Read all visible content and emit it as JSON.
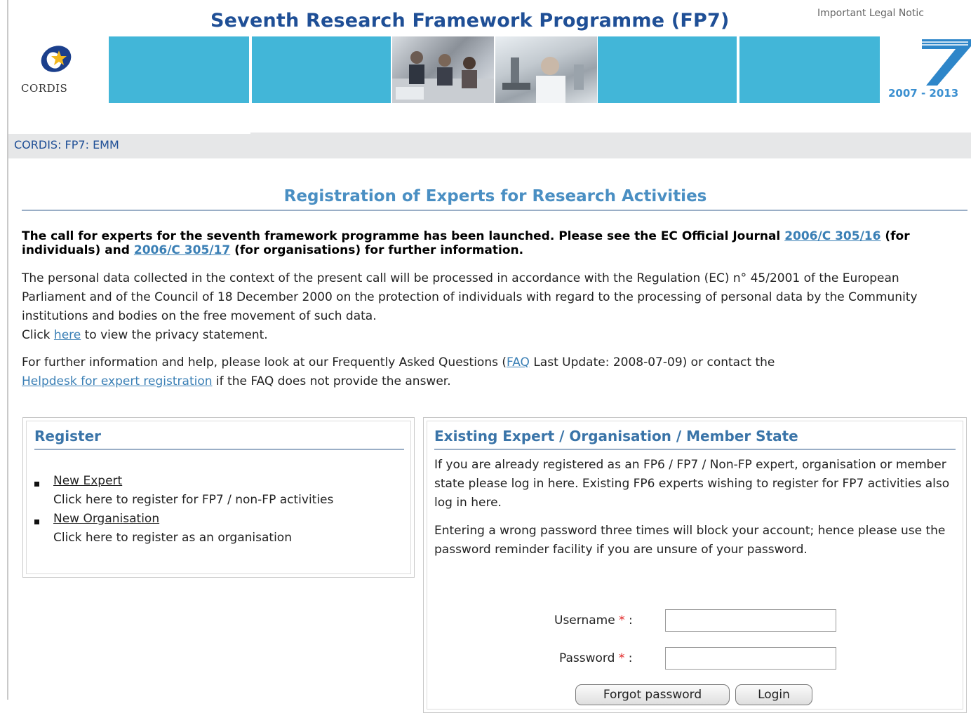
{
  "header": {
    "title": "Seventh Research Framework Programme (FP7)",
    "legal_notice": "Important Legal Notic",
    "logo_text": "CORDIS",
    "fp7_years": "2007 - 2013"
  },
  "breadcrumb": "CORDIS: FP7: EMM",
  "page_title": "Registration of Experts for Research Activities",
  "announcement": {
    "text_before": "The call for experts for the seventh framework programme has been launched. Please see the EC Official Journal",
    "link1": "2006/C 305/16",
    "text_mid": "(for individuals) and",
    "link2": "2006/C 305/17",
    "text_after": "(for organisations) for further information."
  },
  "privacy": {
    "text": "The personal data collected in the context of the present call will be processed in accordance with the Regulation (EC) n° 45/2001 of the European Parliament and of the Council of 18 December 2000 on the protection of individuals with regard to the processing of personal data by the Community institutions and bodies on the free movement of such data.",
    "click_prefix": "Click",
    "here_link": "here",
    "click_suffix": "to view the privacy statement."
  },
  "help": {
    "text_before": "For further information and help, please look at our Frequently Asked Questions (",
    "faq_link": "FAQ",
    "text_mid": "Last Update: 2008-07-09) or contact the",
    "helpdesk_link": "Helpdesk for expert registration",
    "text_after": "if the FAQ does not provide the answer."
  },
  "register": {
    "heading": "Register",
    "items": [
      {
        "link": "New Expert",
        "desc": "Click here to register for FP7 / non-FP activities"
      },
      {
        "link": "New Organisation",
        "desc": "Click here to register as an organisation"
      }
    ]
  },
  "login": {
    "heading": "Existing Expert / Organisation / Member State",
    "para1": "If you are already registered as an FP6 / FP7 / Non-FP expert, organisation or member state please log in here. Existing FP6 experts wishing to register for FP7 activities also log in here.",
    "para2": "Entering a wrong password three times will block your account; hence please use the password reminder facility if you are unsure of your password.",
    "username_label": "Username",
    "password_label": "Password",
    "required_mark": "*",
    "username_value": "",
    "password_value": "",
    "forgot_button": "Forgot password",
    "login_button": "Login"
  },
  "colors": {
    "banner": "#42b6d8",
    "title": "#1f4f96",
    "link": "#3a7fb5",
    "heading": "#3a74a8"
  }
}
